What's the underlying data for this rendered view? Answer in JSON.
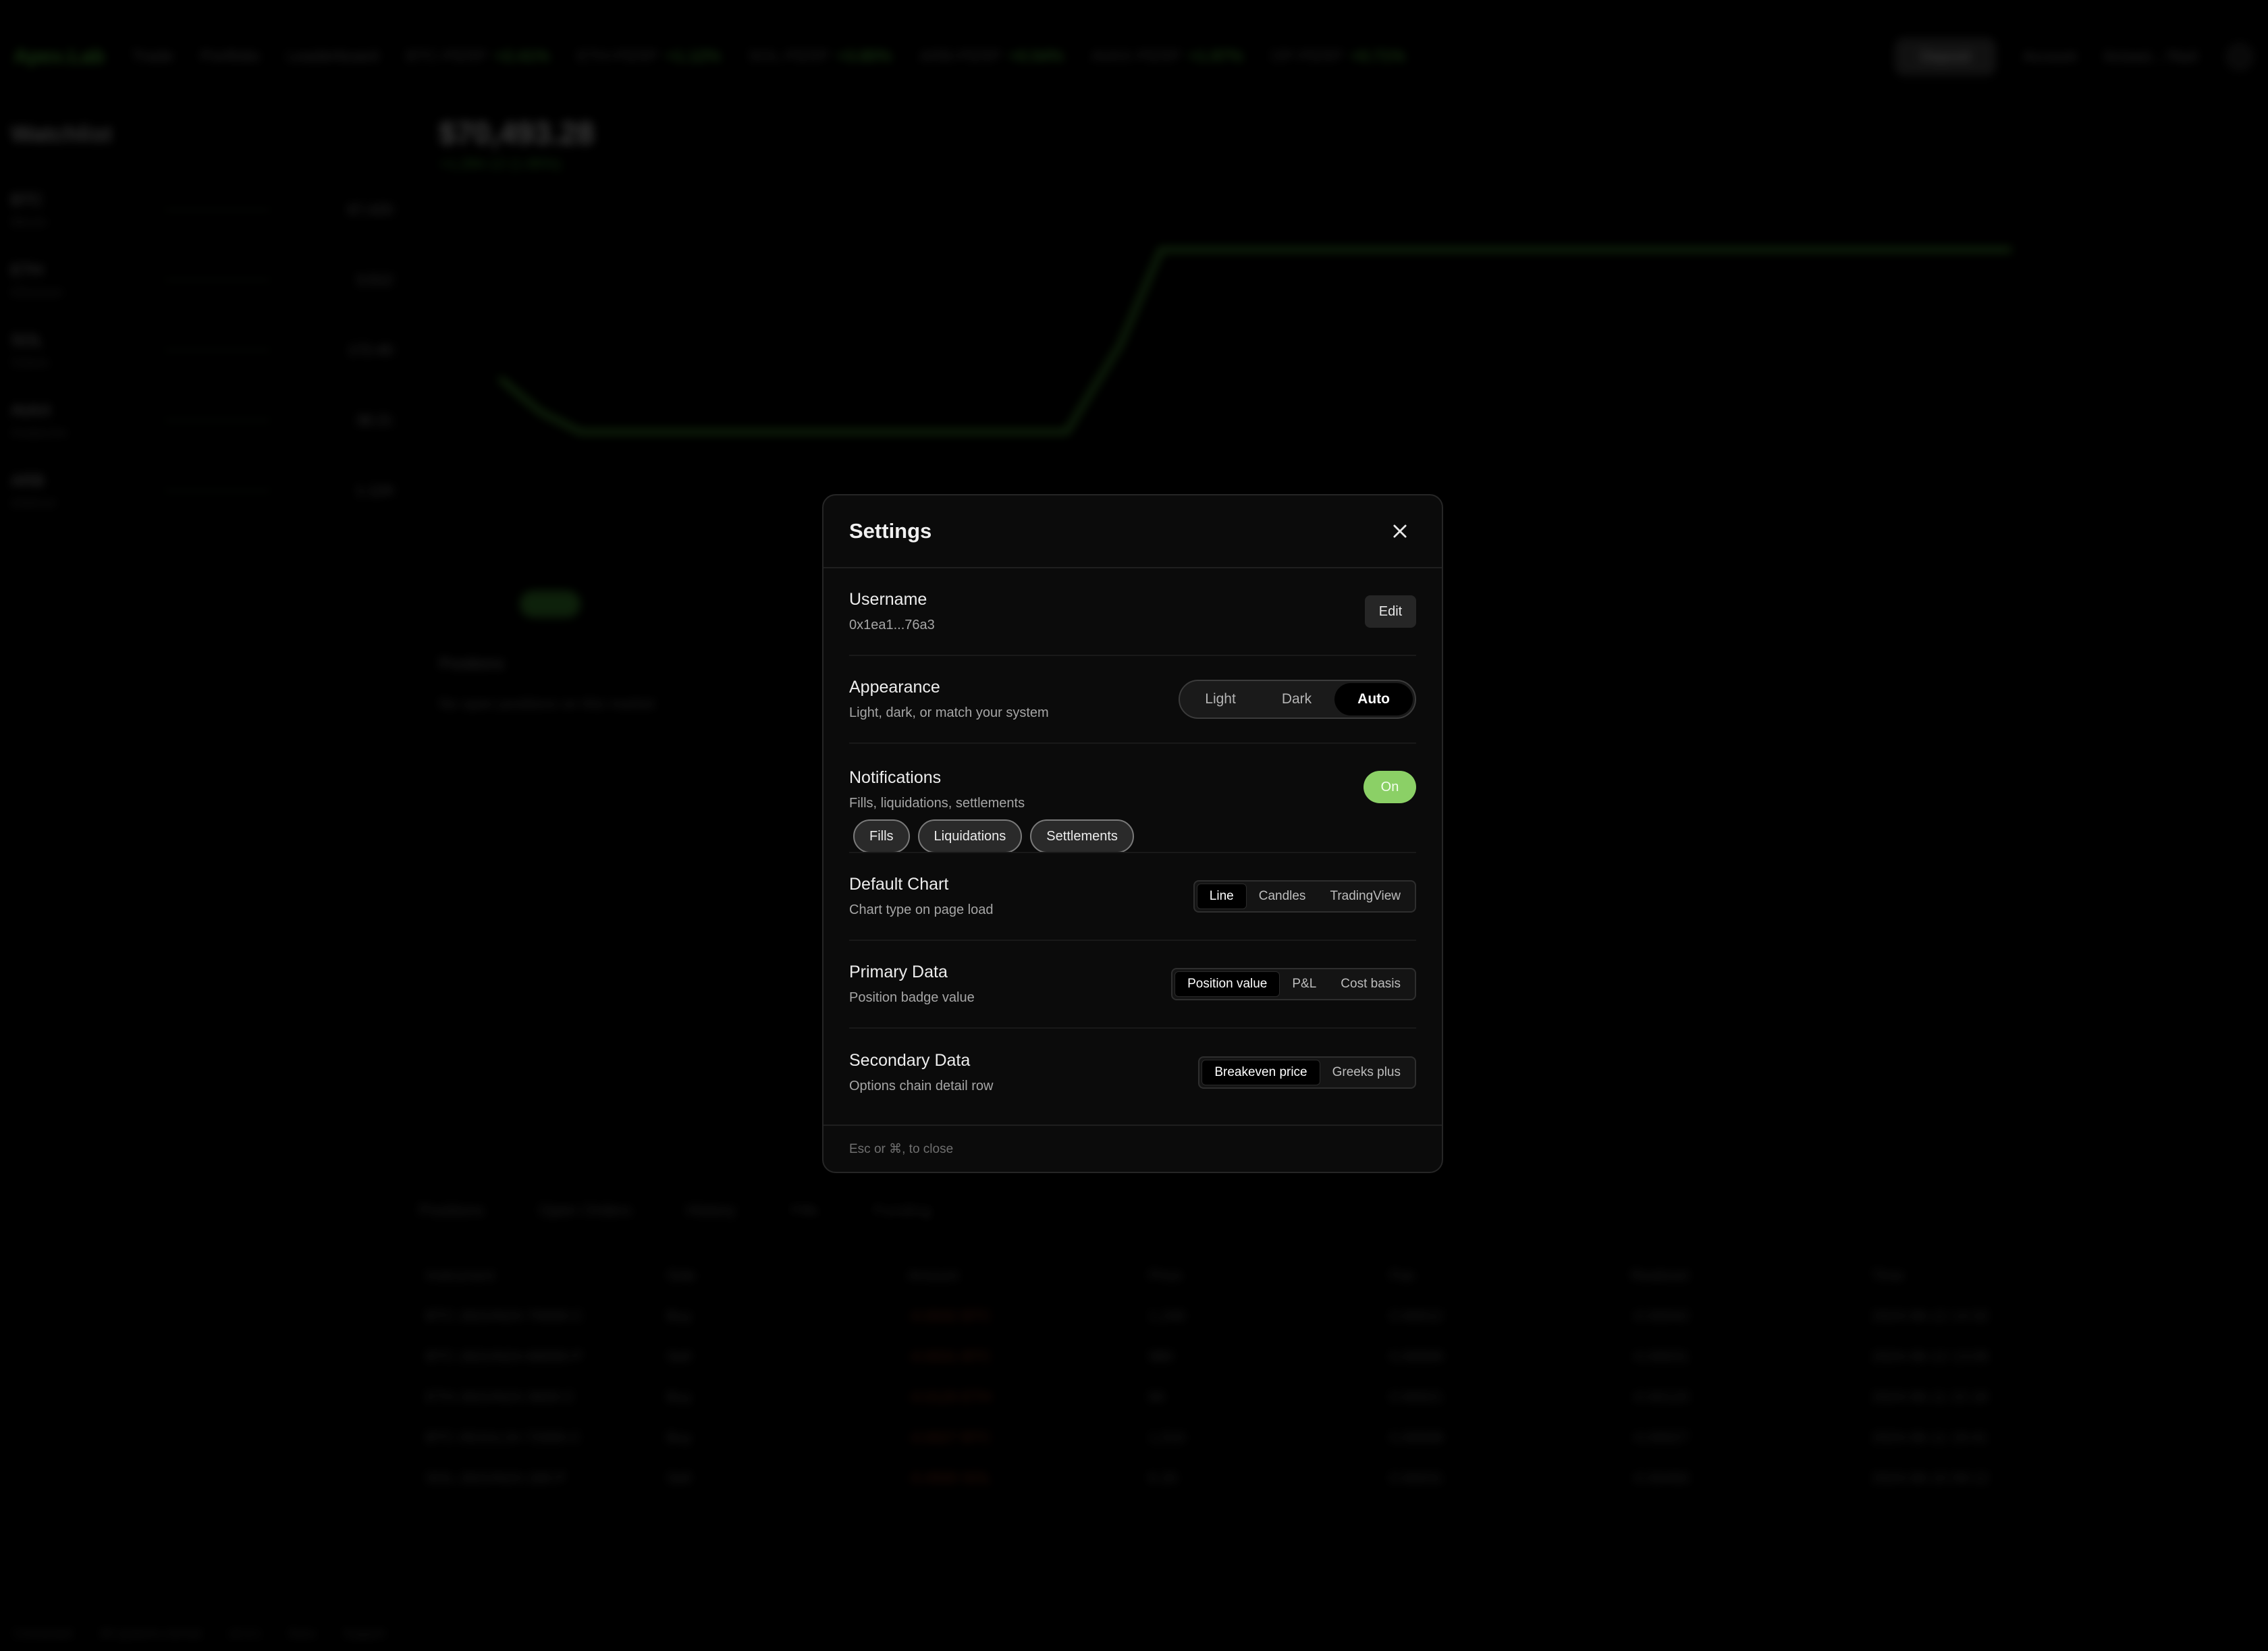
{
  "background": {
    "logo": "Apex.Lab",
    "nav": [
      "Trade",
      "Portfolio",
      "Leaderboard"
    ],
    "tickers": [
      {
        "name": "BTC-PERP",
        "value": "+2.41%"
      },
      {
        "name": "ETH-PERP",
        "value": "+1.12%"
      },
      {
        "name": "SOL-PERP",
        "value": "+3.80%"
      },
      {
        "name": "ARB-PERP",
        "value": "+0.54%"
      },
      {
        "name": "AVAX-PERP",
        "value": "+1.97%"
      },
      {
        "name": "OP-PERP",
        "value": "+0.71%"
      }
    ],
    "cta": "Deposit",
    "account_pill": "Account",
    "wallet_pill": "0x1ea1...76a3",
    "watchlist_title": "Watchlist",
    "watchlist": [
      {
        "t": "BTC",
        "s": "Bitcoin",
        "px": "67,420"
      },
      {
        "t": "ETH",
        "s": "Ethereum",
        "px": "3,512"
      },
      {
        "t": "SOL",
        "s": "Solana",
        "px": "172.40"
      },
      {
        "t": "AVAX",
        "s": "Avalanche",
        "px": "38.21"
      },
      {
        "t": "ARB",
        "s": "Arbitrum",
        "px": "1.124"
      }
    ],
    "price": "$70,493.28",
    "change": "+1,284.12 (1.85%)",
    "positions_title": "Positions",
    "positions_text": "No open positions on this market",
    "tabs": [
      "Positions",
      "Open Orders",
      "History",
      "Fills",
      "Funding"
    ],
    "table_header": [
      "Instrument",
      "Side",
      "Amount",
      "Price",
      "Fee",
      "Realized",
      "Time"
    ],
    "table_rows": [
      [
        "BTC-28JUN24-70000-C",
        "Buy",
        "-0.0042 BTC",
        "1,240",
        "0.00012",
        "-0.00042",
        "2024-06-12 14:32"
      ],
      [
        "BTC-28JUN24-68000-P",
        "Sell",
        "-0.0031 BTC",
        "980",
        "0.00009",
        "-0.00031",
        "2024-06-12 13:05"
      ],
      [
        "ETH-28JUN24-3600-C",
        "Buy",
        "-0.0120 ETH",
        "84",
        "0.00021",
        "-0.00120",
        "2024-06-11 22:18"
      ],
      [
        "BTC-05JUL24-72000-C",
        "Buy",
        "-0.0027 BTC",
        "1,510",
        "0.00008",
        "-0.00027",
        "2024-06-11 19:41"
      ],
      [
        "SOL-28JUN24-180-P",
        "Sell",
        "-0.4500 SOL",
        "6.20",
        "0.00031",
        "-0.00450",
        "2024-06-10 09:12"
      ]
    ],
    "footer": [
      "Connected",
      "All systems normal",
      "v2.4.1",
      "Docs",
      "Support"
    ]
  },
  "modal": {
    "title": "Settings",
    "username": {
      "label": "Username",
      "value": "0x1ea1...76a3",
      "edit_label": "Edit"
    },
    "appearance": {
      "label": "Appearance",
      "sub": "Light, dark, or match your system",
      "options": [
        "Light",
        "Dark",
        "Auto"
      ],
      "selected": "Auto"
    },
    "notifications": {
      "label": "Notifications",
      "sub": "Fills, liquidations, settlements",
      "toggle_label": "On",
      "chips": [
        "Fills",
        "Liquidations",
        "Settlements"
      ]
    },
    "default_chart": {
      "label": "Default Chart",
      "sub": "Chart type on page load",
      "options": [
        "Line",
        "Candles",
        "TradingView"
      ],
      "selected": "Line"
    },
    "primary_data": {
      "label": "Primary Data",
      "sub": "Position badge value",
      "options": [
        "Position value",
        "P&L",
        "Cost basis"
      ],
      "selected": "Position value"
    },
    "secondary_data": {
      "label": "Secondary Data",
      "sub": "Options chain detail row",
      "options": [
        "Breakeven price",
        "Greeks plus"
      ],
      "selected": "Breakeven price"
    },
    "footer_hint": "Esc or ⌘, to close"
  },
  "colors": {
    "accent_green": "#8bd066",
    "modal_bg": "#0b0b0b",
    "brand_green": "#4fb33a",
    "loss_red": "#8c3a22"
  },
  "icons": {
    "close": "close-icon"
  }
}
